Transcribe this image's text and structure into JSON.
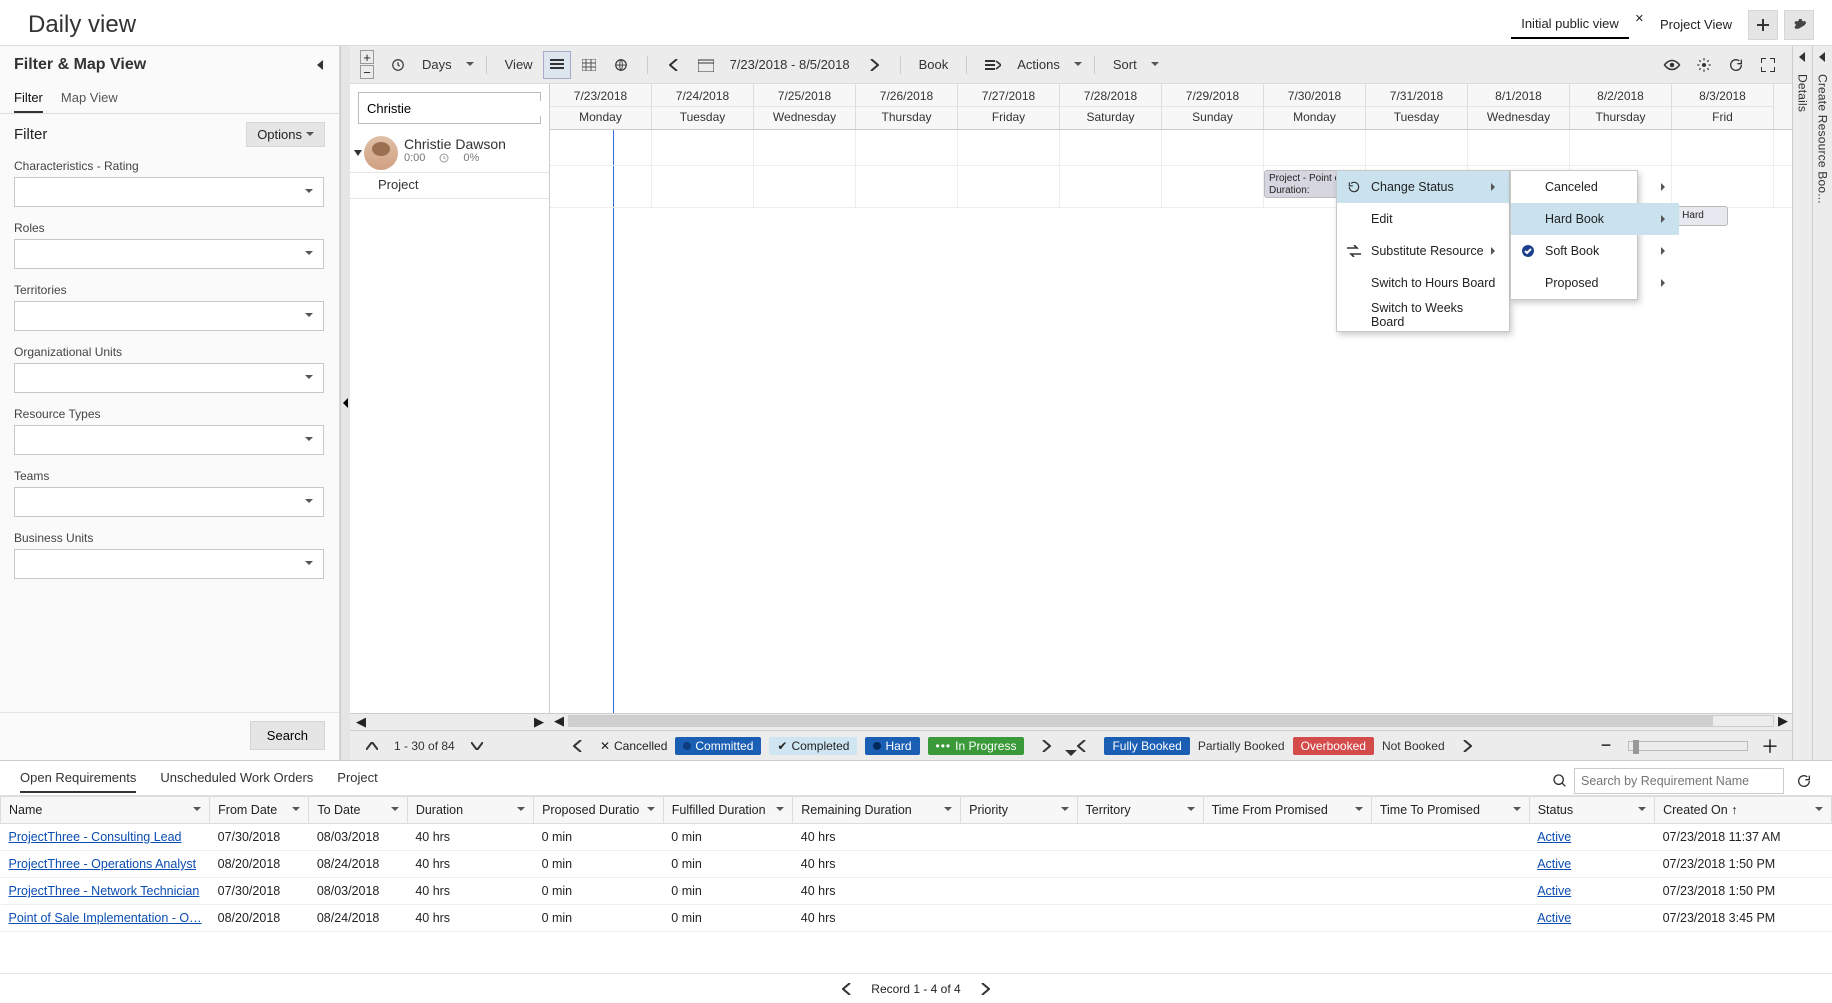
{
  "header": {
    "title": "Daily view",
    "active_view": "Initial public view",
    "other_view": "Project View"
  },
  "left": {
    "panel_title": "Filter & Map View",
    "tabs": {
      "filter": "Filter",
      "map": "Map View"
    },
    "filter_label": "Filter",
    "options_label": "Options",
    "groups": [
      "Characteristics - Rating",
      "Roles",
      "Territories",
      "Organizational Units",
      "Resource Types",
      "Teams",
      "Business Units"
    ],
    "search_btn": "Search"
  },
  "toolbar": {
    "days": "Days",
    "view": "View",
    "range": "7/23/2018 - 8/5/2018",
    "book": "Book",
    "actions": "Actions",
    "sort": "Sort"
  },
  "resources": {
    "search_value": "Christie",
    "rows": [
      {
        "name": "Christie Dawson",
        "hours": "0:00",
        "pct": "0%",
        "project_label": "Project"
      }
    ]
  },
  "calendar": {
    "cols": [
      {
        "date": "7/23/2018",
        "dow": "Monday"
      },
      {
        "date": "7/24/2018",
        "dow": "Tuesday"
      },
      {
        "date": "7/25/2018",
        "dow": "Wednesday"
      },
      {
        "date": "7/26/2018",
        "dow": "Thursday"
      },
      {
        "date": "7/27/2018",
        "dow": "Friday"
      },
      {
        "date": "7/28/2018",
        "dow": "Saturday"
      },
      {
        "date": "7/29/2018",
        "dow": "Sunday"
      },
      {
        "date": "7/30/2018",
        "dow": "Monday"
      },
      {
        "date": "7/31/2018",
        "dow": "Tuesday"
      },
      {
        "date": "8/1/2018",
        "dow": "Wednesday"
      },
      {
        "date": "8/2/2018",
        "dow": "Thursday"
      },
      {
        "date": "8/3/2018",
        "dow": "Frid"
      }
    ],
    "booking": {
      "line1": "Project - Point of Sale Implemen",
      "line2": "Duration:"
    },
    "hard_badge": "Hard"
  },
  "context": {
    "menu1": [
      {
        "label": "Change Status",
        "icon": "status",
        "arrow": true,
        "hi": true
      },
      {
        "label": "Edit"
      },
      {
        "label": "Substitute Resource",
        "icon": "swap",
        "arrow": true
      },
      {
        "label": "Switch to Hours Board"
      },
      {
        "label": "Switch to Weeks Board"
      }
    ],
    "menu2": [
      {
        "label": "Canceled",
        "arrow": true
      },
      {
        "label": "Hard Book",
        "arrow": true,
        "hi": true
      },
      {
        "label": "Soft Book",
        "arrow": true,
        "icon": "check"
      },
      {
        "label": "Proposed",
        "arrow": true
      }
    ]
  },
  "footer": {
    "paging": "1 - 30 of 84",
    "legend": {
      "cancelled": "Cancelled",
      "committed": "Committed",
      "completed": "Completed",
      "hard": "Hard",
      "inprog": "In Progress",
      "fully": "Fully Booked",
      "partial": "Partially Booked",
      "over": "Overbooked",
      "not": "Not Booked"
    }
  },
  "rails": {
    "details": "Details",
    "create": "Create Resource Boo..."
  },
  "bottom": {
    "tabs": {
      "open": "Open Requirements",
      "unsched": "Unscheduled Work Orders",
      "project": "Project"
    },
    "search_ph": "Search by Requirement Name",
    "cols": [
      "Name",
      "From Date",
      "To Date",
      "Duration",
      "Proposed Duratio",
      "Fulfilled Duration",
      "Remaining Duration",
      "Priority",
      "Territory",
      "Time From Promised",
      "Time To Promised",
      "Status",
      "Created On"
    ],
    "rows": [
      {
        "n": "ProjectThree - Consulting Lead",
        "f": "07/30/2018",
        "t": "08/03/2018",
        "d": "40 hrs",
        "p": "0 min",
        "ff": "0 min",
        "r": "40 hrs",
        "st": "Active",
        "c": "07/23/2018 11:37 AM"
      },
      {
        "n": "ProjectThree - Operations Analyst",
        "f": "08/20/2018",
        "t": "08/24/2018",
        "d": "40 hrs",
        "p": "0 min",
        "ff": "0 min",
        "r": "40 hrs",
        "st": "Active",
        "c": "07/23/2018 1:50 PM"
      },
      {
        "n": "ProjectThree - Network Technician",
        "f": "07/30/2018",
        "t": "08/03/2018",
        "d": "40 hrs",
        "p": "0 min",
        "ff": "0 min",
        "r": "40 hrs",
        "st": "Active",
        "c": "07/23/2018 1:50 PM"
      },
      {
        "n": "Point of Sale Implementation - O…",
        "f": "08/20/2018",
        "t": "08/24/2018",
        "d": "40 hrs",
        "p": "0 min",
        "ff": "0 min",
        "r": "40 hrs",
        "st": "Active",
        "c": "07/23/2018 3:45 PM"
      }
    ],
    "record_foot": "Record 1 - 4 of 4"
  }
}
